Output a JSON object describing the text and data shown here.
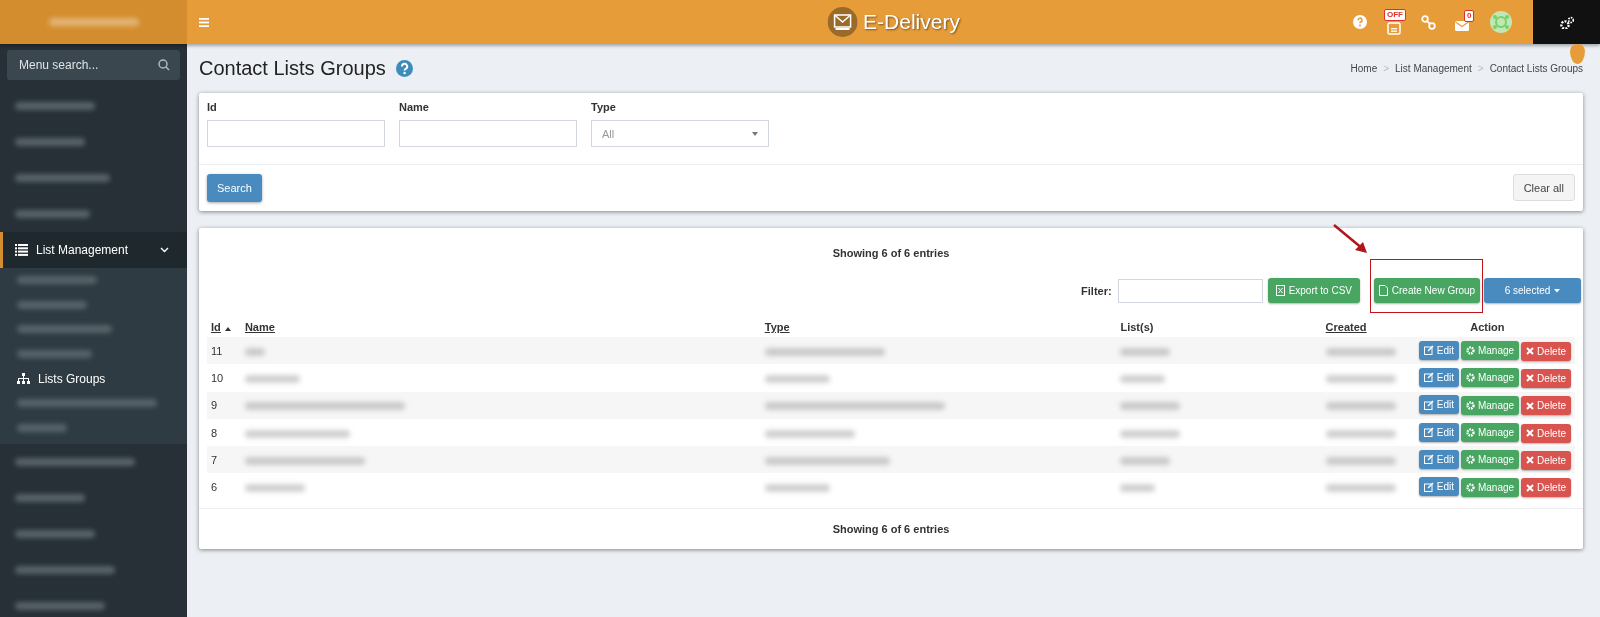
{
  "header": {
    "title": "E-Delivery",
    "status_badge": "OFF",
    "messages_badge": "0"
  },
  "sidebar": {
    "search_placeholder": "Menu search...",
    "items": [
      {
        "label": "List Management",
        "expanded": true,
        "children": [
          {
            "label": "Lists Groups",
            "selected": true
          }
        ]
      }
    ]
  },
  "page": {
    "title": "Contact Lists Groups",
    "breadcrumb": [
      {
        "label": "Home",
        "separator": ">"
      },
      {
        "label": "List Management",
        "separator": ">"
      },
      {
        "label": "Contact Lists Groups"
      }
    ]
  },
  "filters": {
    "fields": [
      {
        "label": "Id",
        "kind": "text"
      },
      {
        "label": "Name",
        "kind": "text"
      },
      {
        "label": "Type",
        "kind": "select",
        "value": "All"
      }
    ],
    "search_button": "Search",
    "clear_button": "Clear all"
  },
  "table": {
    "summary_top": "Showing 6 of 6 entries",
    "filter_label": "Filter:",
    "export_button": "Export to CSV",
    "create_button": "Create New Group",
    "selection_button": "6 selected",
    "columns": [
      {
        "label": "Id",
        "sortable": true,
        "sorted": true
      },
      {
        "label": "Name",
        "sortable": true,
        "sorted": false
      },
      {
        "label": "Type",
        "sortable": true,
        "sorted": false
      },
      {
        "label": "List(s)",
        "sortable": false,
        "sorted": false
      },
      {
        "label": "Created",
        "sortable": true,
        "sorted": false
      },
      {
        "label": "Action",
        "sortable": false,
        "sorted": false
      }
    ],
    "rows": [
      {
        "id": "11",
        "actions": [
          "Edit",
          "Manage",
          "Delete"
        ]
      },
      {
        "id": "10",
        "actions": [
          "Edit",
          "Manage",
          "Delete"
        ]
      },
      {
        "id": "9",
        "actions": [
          "Edit",
          "Manage",
          "Delete"
        ]
      },
      {
        "id": "8",
        "actions": [
          "Edit",
          "Manage",
          "Delete"
        ]
      },
      {
        "id": "7",
        "actions": [
          "Edit",
          "Manage",
          "Delete"
        ]
      },
      {
        "id": "6",
        "actions": [
          "Edit",
          "Manage",
          "Delete"
        ]
      }
    ],
    "summary_bottom": "Showing 6 of 6 entries"
  },
  "annotation": {
    "highlight": true
  }
}
